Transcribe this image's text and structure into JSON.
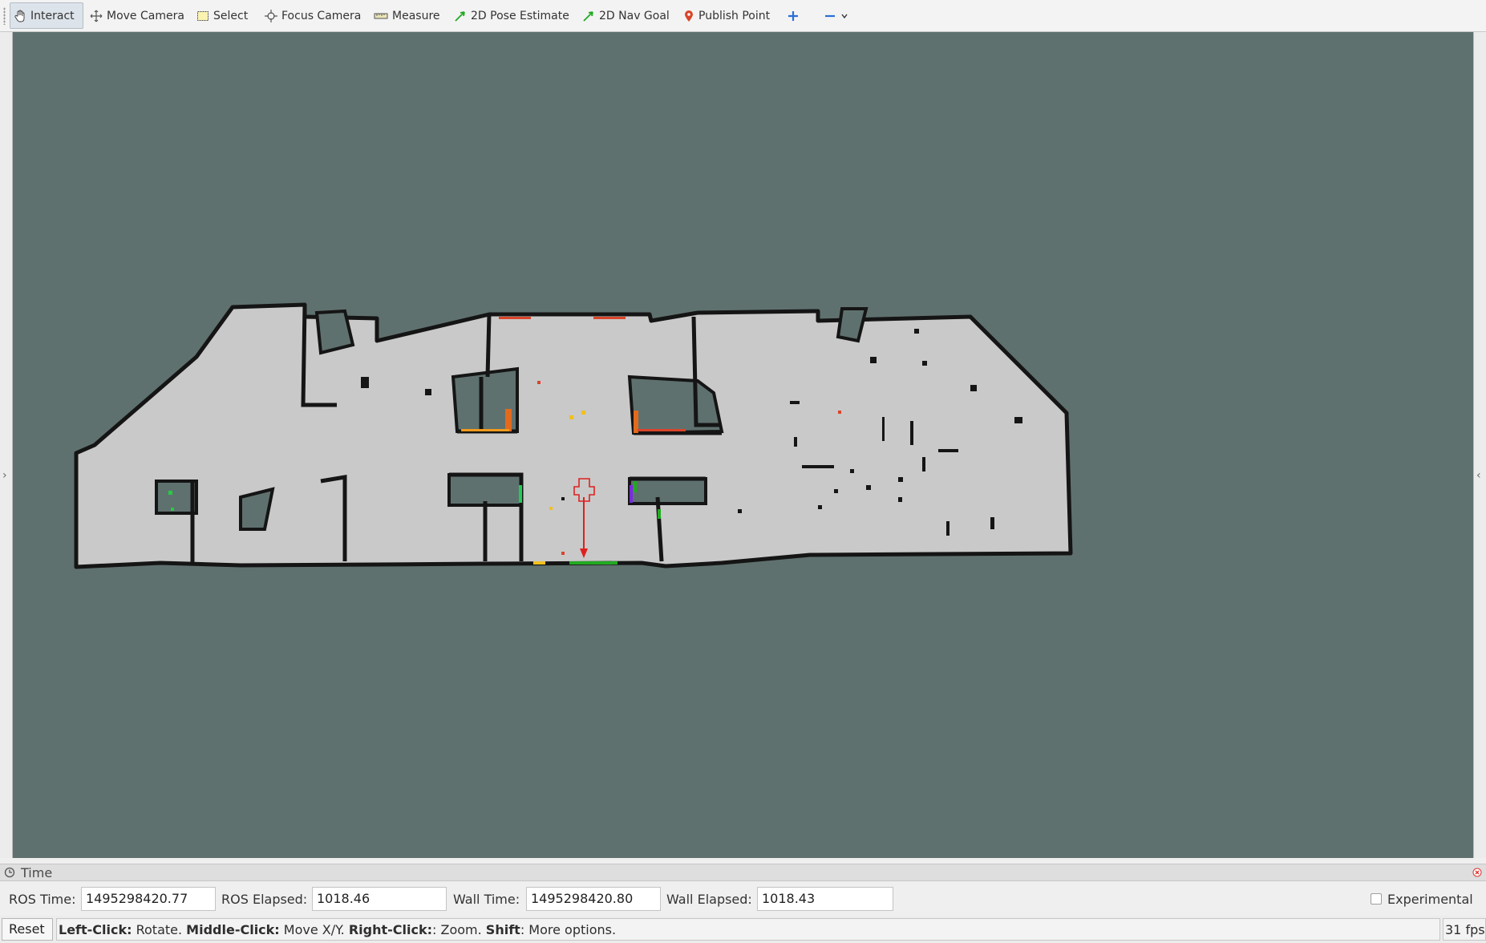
{
  "toolbar": {
    "tools": [
      {
        "label": "Interact",
        "icon": "hand-icon",
        "active": true
      },
      {
        "label": "Move Camera",
        "icon": "move-camera-icon"
      },
      {
        "label": "Select",
        "icon": "select-icon"
      },
      {
        "label": "Focus Camera",
        "icon": "focus-camera-icon"
      },
      {
        "label": "Measure",
        "icon": "measure-icon"
      },
      {
        "label": "2D Pose Estimate",
        "icon": "pose-arrow-icon",
        "color": "#22aa22"
      },
      {
        "label": "2D Nav Goal",
        "icon": "nav-goal-arrow-icon",
        "color": "#22aa22"
      },
      {
        "label": "Publish Point",
        "icon": "map-pin-icon",
        "color": "#d9442a"
      }
    ],
    "extra_icons": [
      "plus-icon",
      "minus-icon",
      "chevron-down-icon"
    ]
  },
  "viewport": {
    "background": "#5f716f",
    "map_free_color": "#c8c8c8",
    "map_wall_color": "#111111",
    "robot_color": "#e02020"
  },
  "time_panel": {
    "title": "Time",
    "ros_time_label": "ROS Time:",
    "ros_time": "1495298420.77",
    "ros_elapsed_label": "ROS Elapsed:",
    "ros_elapsed": "1018.46",
    "wall_time_label": "Wall Time:",
    "wall_time": "1495298420.80",
    "wall_elapsed_label": "Wall Elapsed:",
    "wall_elapsed": "1018.43",
    "experimental_label": "Experimental",
    "experimental_checked": false
  },
  "status_bar": {
    "reset_label": "Reset",
    "help": [
      {
        "key": "Left-Click:",
        "text": " Rotate. "
      },
      {
        "key": "Middle-Click:",
        "text": " Move X/Y. "
      },
      {
        "key": "Right-Click:",
        "text": ": Zoom. "
      },
      {
        "key": "Shift",
        "text": ": More options."
      }
    ],
    "fps": "31 fps"
  }
}
